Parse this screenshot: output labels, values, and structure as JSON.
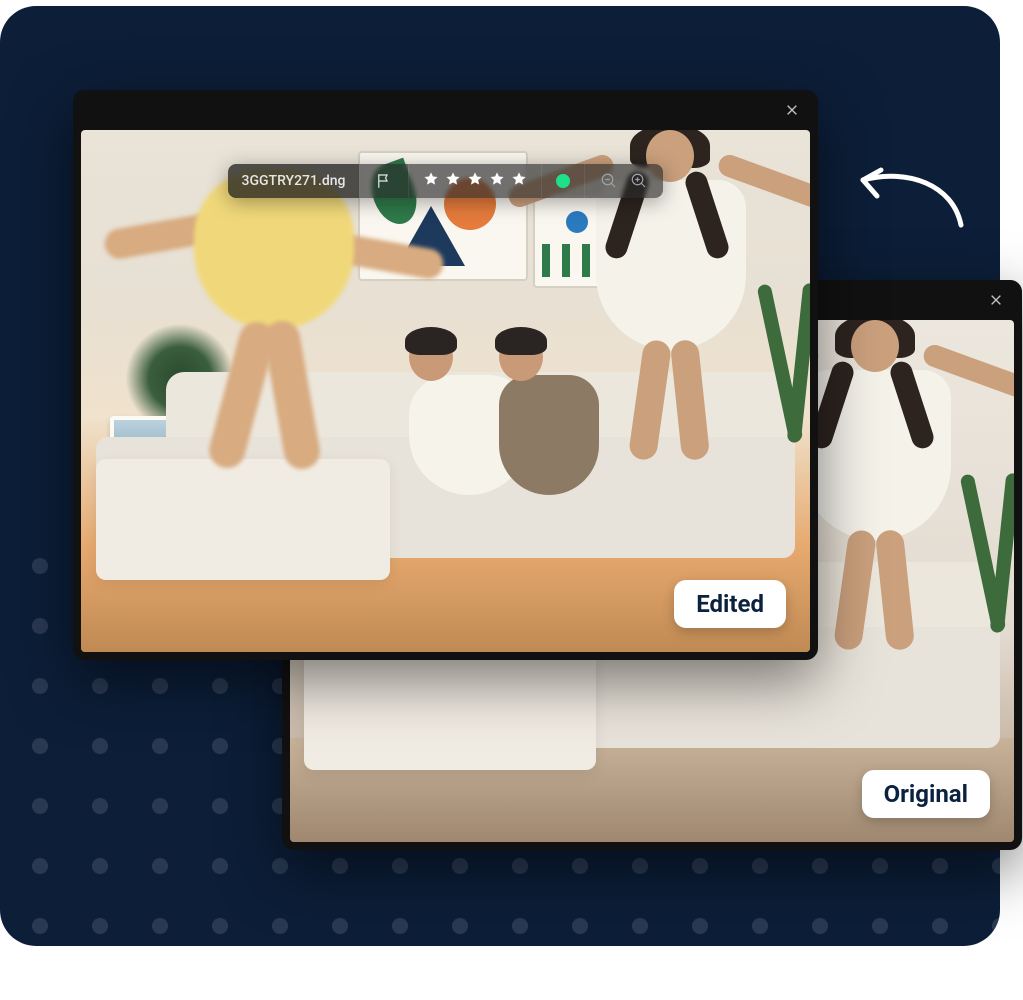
{
  "editor": {
    "filename": "3GGTRY271.dng",
    "rating_stars": 5,
    "color_label": "green",
    "color_hex": "#1fe08a"
  },
  "labels": {
    "edited": "Edited",
    "original": "Original"
  },
  "icons": {
    "close": "close",
    "flag": "flag",
    "zoom_out": "zoom-out",
    "zoom_in": "zoom-in"
  }
}
